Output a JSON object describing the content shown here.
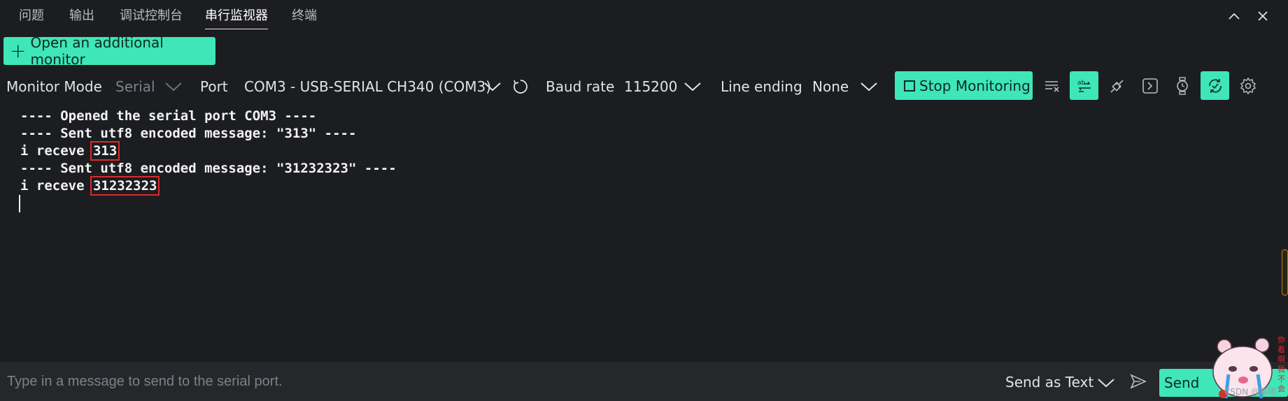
{
  "tabs": [
    {
      "label": "问题"
    },
    {
      "label": "输出"
    },
    {
      "label": "调试控制台"
    },
    {
      "label": "串行监视器",
      "active": true
    },
    {
      "label": "终端"
    }
  ],
  "panel_controls": {
    "collapse_icon": "chevron-up-icon",
    "close_icon": "close-icon"
  },
  "add_monitor": {
    "icon": "plus-icon",
    "label": "Open an additional monitor"
  },
  "toolbar": {
    "monitor_mode_label": "Monitor Mode",
    "monitor_mode_value": "Serial",
    "port_label": "Port",
    "port_value": "COM3 - USB-SERIAL CH340 (COM3)",
    "baud_label": "Baud rate",
    "baud_value": "115200",
    "line_ending_label": "Line ending",
    "line_ending_value": "None",
    "stop_label": "Stop Monitoring",
    "icons": [
      "clear-output-icon",
      "toggle-hex-icon",
      "connect-icon",
      "terminal-icon",
      "timestamp-icon",
      "autoscroll-icon",
      "settings-icon"
    ]
  },
  "console": {
    "lines": [
      {
        "text": "---- Opened the serial port COM3 ----"
      },
      {
        "text": "---- Sent utf8 encoded message: \"313\" ----"
      },
      {
        "prefix": "i receve ",
        "highlight": "313"
      },
      {
        "text": "---- Sent utf8 encoded message: \"31232323\" ----"
      },
      {
        "prefix": "i receve ",
        "highlight": "31232323"
      }
    ]
  },
  "input": {
    "placeholder": "Type in a message to send to the serial port.",
    "value": "",
    "send_as_label": "Send as Text",
    "send_label": "Send"
  },
  "watermark": {
    "text": "CSDN @韦珺"
  },
  "colors": {
    "accent": "#3ee6b8",
    "background": "#1c1d21",
    "highlight_box": "#e0282c",
    "input_bar": "#26272b"
  }
}
